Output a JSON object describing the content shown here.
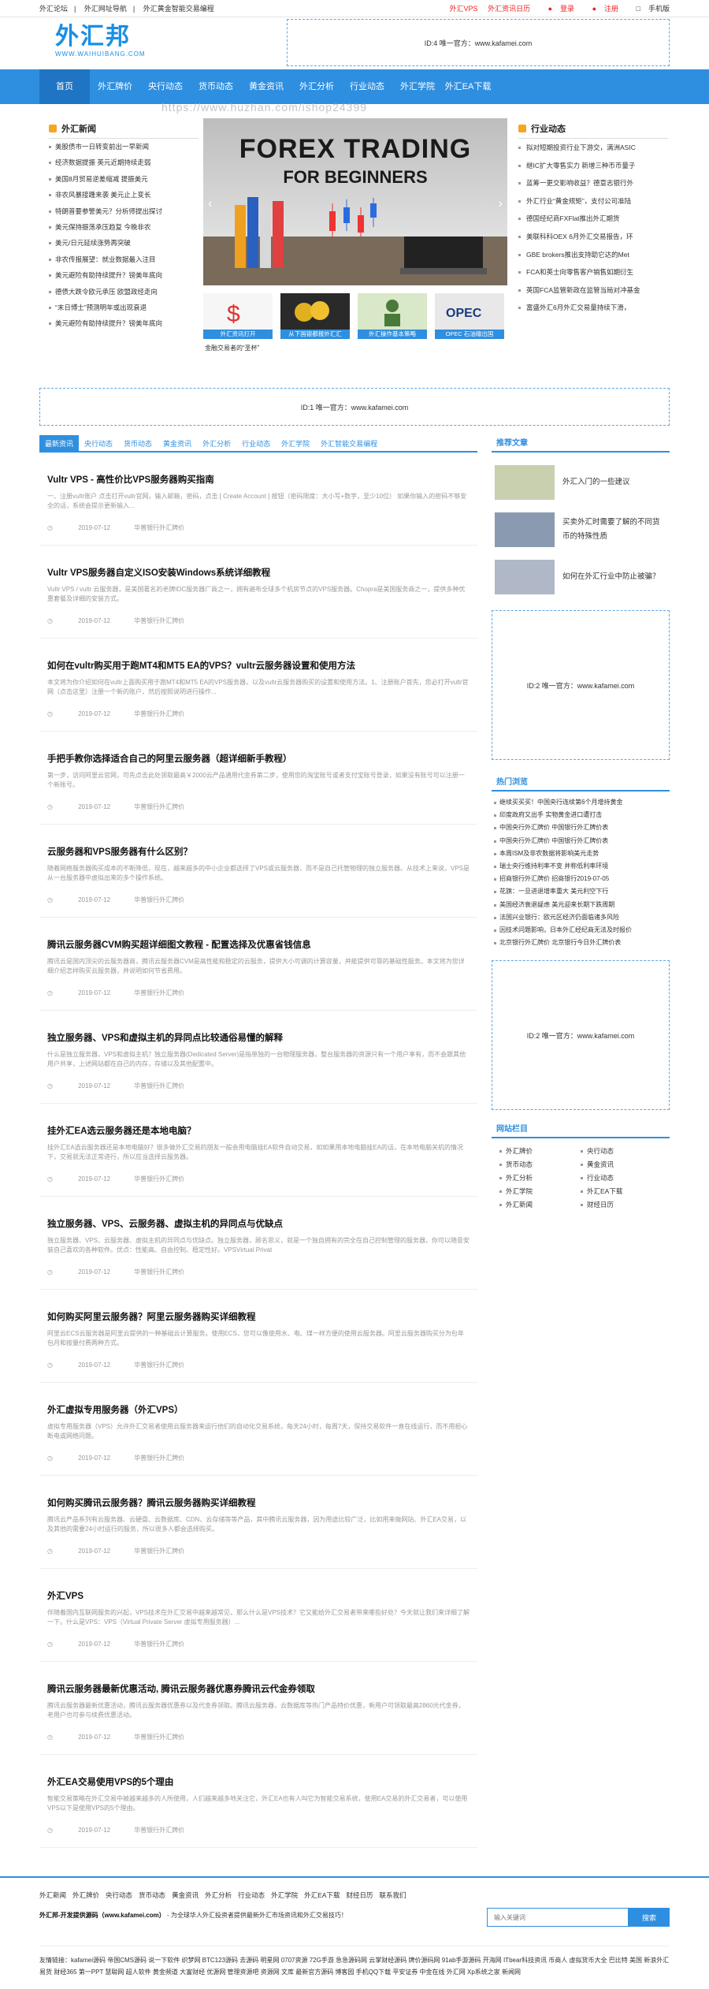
{
  "topbar": {
    "left": [
      "外汇论坛",
      "外汇网址导航",
      "外汇黄金智能交易编程"
    ],
    "right": [
      "外汇VPS",
      "外汇资讯日历",
      "登录",
      "注册",
      "手机版"
    ]
  },
  "logo": {
    "cn": "外汇邦",
    "en": "WWW.WAIHUIBANG.COM"
  },
  "header_ad": "ID:4 唯一官方：www.kafamei.com",
  "nav": [
    "首页",
    "外汇牌价",
    "央行动态",
    "货币动态",
    "黄金资讯",
    "外汇分析",
    "行业动态",
    "外汇学院",
    "外汇EA下载"
  ],
  "watermark": "https://www.huzhan.com/ishop24399",
  "left_news": {
    "title": "外汇新闻",
    "items": [
      "美股债市一日转变前出一早新闻",
      "经济数据提振 英元近期持续走弱",
      "美国8月贸易逆差缩减 提振美元",
      "非农风暴接踵来袭 美元止上变长",
      "特朗普要参警美元？分析师提出探讨",
      "美元保持振荡承压趋复 今晚非农",
      "美元/日元延续涨势再突破",
      "非农传报展望：就业数据最入注目",
      "美元避险有助持续提升？镑美年底向",
      "德债大跌令欧元承压 欧盟政经走向",
      "“末日博士”预测明年或出现衰退",
      "美元避险有助持续提升？镑美年底向"
    ]
  },
  "slider": {
    "line1": "FOREX TRADING",
    "line2": "FOR BEGINNERS"
  },
  "thumbs": [
    "外汇资讯打开",
    "从下国银都报外汇汇",
    "外汇操作基本策略",
    "OPEC 石油输出国"
  ],
  "thumbs_sub": "金融交易者的“圣杯”",
  "right_news": {
    "title": "行业动态",
    "items": [
      "拟对短期投资行业下游交，满洲ASIC",
      "继IC扩大零售实力 新增三种币币量子",
      "蓝筹一更交影响收益？德意志银行外",
      "外汇行业“黄金规矩”，支付公司准陆",
      "德国经纪商FXFlat推出外汇期货",
      "美联科科OEX 6月外汇交易报告，环",
      "GBE brokers推出支持助它达的Met",
      "FCA和英士向零售客户销售如期衍生",
      "英国FCA监管新政在监管当局对冲基金",
      "富盛外汇6月外汇交易量持续下滑，"
    ]
  },
  "ad_mid": "ID:1 唯一官方：www.kafamei.com",
  "tabs": [
    "最新资讯",
    "央行动态",
    "货币动态",
    "黄金资讯",
    "外汇分析",
    "行业动态",
    "外汇学院",
    "外汇智能交易编程"
  ],
  "articles": [
    {
      "title": "Vultr VPS - 高性价比VPS服务器购买指南",
      "summary": "一、注册vultr账户 点击打开vultr官网，输入邮箱，密码，点击 [ Create Account ] 按钮（密码限度：大小写+数字，至少10位） 如果你输入的密码不够安全的话，系统会提示更新输入...",
      "date": "2019-07-12",
      "cat": "华普银行外汇牌价"
    },
    {
      "title": "Vultr VPS服务器自定义ISO安装Windows系统详细教程",
      "summary": "Vultr VPS / vultr 云服务器，是美国著名的老牌IDC服务器厂商之一，拥有遍布全球多个机房节点的VPS服务器。Chopra是美国服务商之一，提供多种优惠套餐及详细的安装方式。",
      "date": "2019-07-12",
      "cat": "华普银行外汇牌价"
    },
    {
      "title": "如何在vultr购买用于跑MT4和MT5 EA的VPS？vultr云服务器设置和使用方法",
      "summary": "本文将为你介绍如何在vultr上面购买用于跑MT4和MT5 EA的VPS服务器，以及vultr云服务器购买的设置和使用方法。1、注册账户首先，您必打开vultr官网（点击这里）注册一个新的账户，然后按照说明进行操作...",
      "date": "2019-07-12",
      "cat": "华普银行外汇牌价"
    },
    {
      "title": "手把手教你选择适合自己的阿里云服务器（超详细新手教程）",
      "summary": "第一步，访问阿里云官网，可先点击此处领取最高￥2000云产品通用代金券第二步，使用您的淘宝账号或者支付宝账号登录，如果没有账号可以注册一个新账号。",
      "date": "2019-07-12",
      "cat": "华普银行外汇牌价"
    },
    {
      "title": "云服务器和VPS服务器有什么区别？",
      "summary": "随着网络服务器购买成本的不断降低，现在，越来越多的中小企业都选择了VPS或云服务器，而不是自己托管物理的独立服务器。从技术上来说，VPS是从一台服务器中虚拟出来的多个操作系统。",
      "date": "2019-07-12",
      "cat": "华普银行外汇牌价"
    },
    {
      "title": "腾讯云服务器CVM购买超详细图文教程 - 配置选择及优惠省钱信息",
      "summary": "腾讯云是国内顶尖的云服务器商，腾讯云服务器CVM是高性能和稳定的云服务，提供大小可调的计算容量，并能提供可靠的基础性服务。本文将为您详细介绍怎样购买云服务器，并说明如何节省费用。",
      "date": "2019-07-12",
      "cat": "华普银行外汇牌价"
    },
    {
      "title": "独立服务器、VPS和虚拟主机的异同点比较通俗易懂的解释",
      "summary": "什么是独立服务器，VPS和虚拟主机？独立服务器(Dedicated Server)是指单独的一台物理服务器，整台服务器的资源只有一个用户享有，而不会跟其他用户共享，上述网站都在自己的内存，存储以及其他配置中。",
      "date": "2019-07-12",
      "cat": "华普银行外汇牌价"
    },
    {
      "title": "挂外汇EA选云服务器还是本地电脑？",
      "summary": "挂外汇EA选云服务器还是本地电脑好？很多做外汇交易的朋友一般会用电脑挂EA软件自动交易，如如果用本地电脑挂EA的话，在本地电脑关机的情况下，交易就无法正常进行，所以应当选择云服务器。",
      "date": "2019-07-12",
      "cat": "华普银行外汇牌价"
    },
    {
      "title": "独立服务器、VPS、云服务器、虚拟主机的异同点与优缺点",
      "summary": "独立服务器、VPS、云服务器、虚拟主机的异同点与优缺点。独立服务器，顾名思义，就是一个独自拥有的完全在自己控制管理的服务器，你可以随意安装自己喜欢的各种软件。优点：性能高、自由控制、稳定性好。VPSVirtual Privat",
      "date": "2019-07-12",
      "cat": "华普银行外汇牌价"
    },
    {
      "title": "如何购买阿里云服务器？阿里云服务器购买详细教程",
      "summary": "阿里云ECS云服务器是阿里云提供的一种基础云计算服务。使用ECS，您可以像使用水、电、煤一样方便的使用云服务器。阿里云服务器购买分为包年包月和按量付费两种方式。",
      "date": "2019-07-12",
      "cat": "华普银行外汇牌价"
    },
    {
      "title": "外汇虚拟专用服务器（外汇VPS）",
      "summary": "虚拟专用服务器（VPS）允许外汇交易者使用云服务器来运行他们的自动化交易系统，每天24小时，每周7天，保持交易软件一直在线运行，而不用担心断电或网络问题。",
      "date": "2019-07-12",
      "cat": "华普银行外汇牌价"
    },
    {
      "title": "如何购买腾讯云服务器？腾讯云服务器购买详细教程",
      "summary": "腾讯云产品系列有云服务器、云硬盘、云数据库、CDN、云存储等等产品，其中腾讯云服务器，因为用途比较广泛，比如用来做网站、外汇EA交易，以及其他的需要24小时运行的服务，所以很多人都会选择购买。",
      "date": "2019-07-12",
      "cat": "华普银行外汇牌价"
    },
    {
      "title": "外汇VPS",
      "summary": "伴随着国内互联网服务的兴起，VPS技术在外汇交易中越来越常见，那么什么是VPS技术？它又能给外汇交易者带来哪些好处？今天就让我们来详细了解一下。什么是VPS：VPS（Virtual Private Server 虚拟专用服务器）...",
      "date": "2019-07-12",
      "cat": "华普银行外汇牌价"
    },
    {
      "title": "腾讯云服务器最新优惠活动, 腾讯云服务器优惠券腾讯云代金券领取",
      "summary": "腾讯云服务器最新优惠活动，腾讯云服务器优惠券以及代金券领取。腾讯云服务器，云数据库等热门产品特价优惠，新用户可领取最高2860元代金券，老用户也可参与续费优惠活动。",
      "date": "2019-07-12",
      "cat": "华普银行外汇牌价"
    },
    {
      "title": "外汇EA交易使用VPS的5个理由",
      "summary": "智能交易策略在外汇交易中被越来越多的人所使用，人们越来越多地关注它，外汇EA也有人叫它为智能交易系统，使用EA交易的外汇交易者，可以使用VPS以下是使用VPS的5个理由。",
      "date": "2019-07-12",
      "cat": "华普银行外汇牌价"
    }
  ],
  "side": {
    "rec_title": "推荐文章",
    "rec": [
      "外汇入门的一些建议",
      "买卖外汇时需要了解的不同货币的特殊性质",
      "如何在外汇行业中防止被骗？"
    ],
    "ad_a": "ID:2 唯一官方：www.kafamei.com",
    "hot_title": "热门浏览",
    "hot": [
      "继续买买买！中国央行连续第6个月增持黄金",
      "印度政府又出手 实物黄金进口遭打击",
      "中国央行外汇牌价 中国银行外汇牌价表",
      "中国央行外汇牌价 中国银行外汇牌价表",
      "本周ISM及非农数据将影响美元走势",
      "瑞士央行维持利率不变 并称低利率环境",
      "招商银行外汇牌价 招商银行2019-07-05",
      "花旗：一旦进退增率重大 美元利空下行",
      "美国经济衰退疑虑 美元迎来长期下跌周期",
      "法国兴业银行：欧元区经济仍面临诸多风险",
      "因技术问题影响，日本外汇经纪商无法及时报价",
      "北京银行外汇牌价 北京银行今日外汇牌价表"
    ],
    "ad_b": "ID:2 唯一官方：www.kafamei.com",
    "cols_title": "网站栏目",
    "cols": [
      "外汇牌价",
      "央行动态",
      "货币动态",
      "黄金资讯",
      "外汇分析",
      "行业动态",
      "外汇学院",
      "外汇EA下载",
      "外汇新闻",
      "财经日历"
    ]
  },
  "footer": {
    "nav": [
      "外汇新闻",
      "外汇牌价",
      "央行动态",
      "货币动态",
      "黄金资讯",
      "外汇分析",
      "行业动态",
      "外汇学院",
      "外汇EA下载",
      "财经日历",
      "联系我们"
    ],
    "copy_bold": "外汇邦-开发提供源码（www.kafamei.com）",
    "copy_rest": " - 为全球华人外汇投资者提供最新外汇市场资讯和外汇交易技巧！",
    "search_placeholder": "输入关键词",
    "search_button": "搜索",
    "links": "友情链接：kafamei源码 帝国CMS源码 说一下软件 织梦网 BTC123源码 去源码 明星网 0707资源 72G手游 急急源码网 云掌财经源码 牌价源码网 91ab手游源码 开海网 ITbear科技资讯 币商人 虚拟货币大全 巴比特 美国 新浪外汇 易货 财经365 第一PPT 慧聪网 超人软件 黄金频道 大富财经 优源网 管理资源吧 资源网 文库 最新官方源码 博客园 手机QQ下载 平安证券 中金在线 外汇网 Xp系统之家 新闻网"
  }
}
